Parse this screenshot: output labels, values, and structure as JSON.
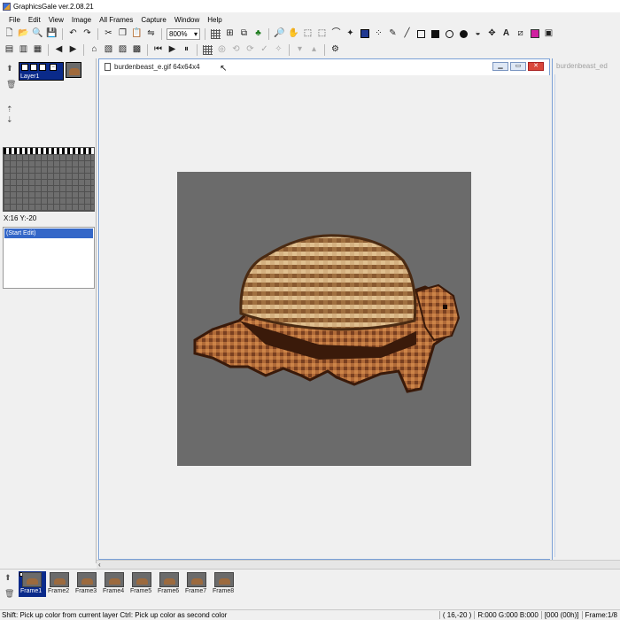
{
  "app": {
    "title": "GraphicsGale ver.2.08.21"
  },
  "menu": [
    "File",
    "Edit",
    "View",
    "Image",
    "All Frames",
    "Capture",
    "Window",
    "Help"
  ],
  "toolbar": {
    "zoom": "800%"
  },
  "layers": {
    "items": [
      {
        "name": "Layer1"
      }
    ]
  },
  "coords": "X:16 Y:-20",
  "history": {
    "items": [
      "(Start Edit)"
    ]
  },
  "document": {
    "title": "burdenbeast_e.gif 64x64x4"
  },
  "second_window": {
    "title": "burdenbeast_ed"
  },
  "frames": [
    {
      "label": "Frame1",
      "active": true
    },
    {
      "label": "Frame2",
      "active": false
    },
    {
      "label": "Frame3",
      "active": false
    },
    {
      "label": "Frame4",
      "active": false
    },
    {
      "label": "Frame5",
      "active": false
    },
    {
      "label": "Frame6",
      "active": false
    },
    {
      "label": "Frame7",
      "active": false
    },
    {
      "label": "Frame8",
      "active": false
    }
  ],
  "status": {
    "hint": "Shift: Pick up color from current layer   Ctrl: Pick up color as second color",
    "position": "( 16,-20 )",
    "color": "R:000 G:000 B:000",
    "index": "[000 (00h)]",
    "frame": "Frame:1/8"
  },
  "colors": {
    "canvas_bg": "#6b6b6b",
    "selection": "#3467c8",
    "active_frame": "#0a2a8a"
  }
}
